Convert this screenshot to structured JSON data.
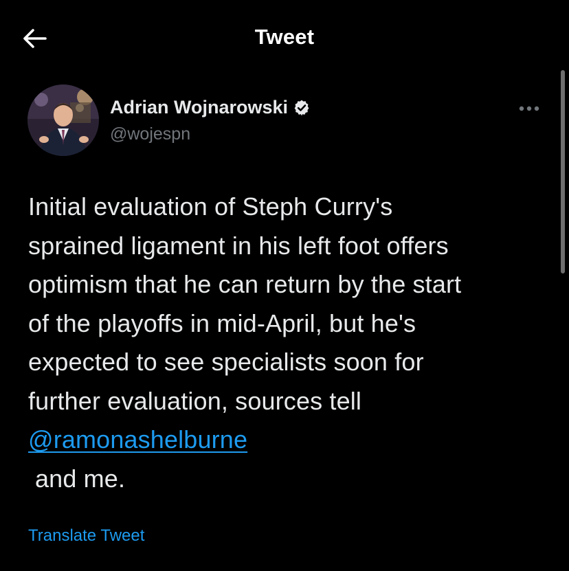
{
  "header": {
    "title": "Tweet",
    "back_icon": "arrow-left-icon"
  },
  "tweet": {
    "author": {
      "name": "Adrian Wojnarowski",
      "handle": "@wojespn",
      "verified_icon": "verified-badge-icon",
      "avatar_icon": "avatar-photo"
    },
    "more_icon": "more-dots-icon",
    "body_lines": [
      "Initial evaluation of Steph Curry's",
      "sprained ligament in his left foot offers",
      "optimism that he can return by the start",
      "of the playoffs in mid-April, but he's",
      "expected to see specialists soon for",
      "further evaluation, sources tell"
    ],
    "mention": "@ramonashelburne",
    "body_tail": "and me.",
    "translate_label": "Translate Tweet"
  },
  "colors": {
    "background": "#000000",
    "text": "#e7e9ea",
    "secondary_text": "#71767b",
    "link": "#1d9bf0"
  }
}
